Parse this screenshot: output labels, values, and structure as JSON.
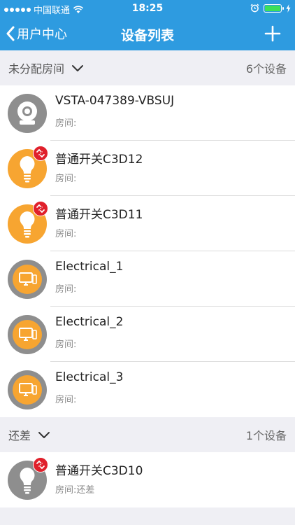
{
  "status_bar": {
    "carrier": "中国联通",
    "time": "18:25"
  },
  "nav": {
    "back_label": "用户中心",
    "title": "设备列表",
    "add_icon": "plus-icon"
  },
  "sections": [
    {
      "name": "未分配房间",
      "count": "6个设备",
      "devices": [
        {
          "name": "VSTA-047389-VBSUJ",
          "room_label": "房间:",
          "room_value": "",
          "icon": "camera-icon",
          "offline_badge": false
        },
        {
          "name": "普通开关C3D12",
          "room_label": "房间:",
          "room_value": "",
          "icon": "bulb-icon",
          "offline_badge": true
        },
        {
          "name": "普通开关C3D11",
          "room_label": "房间:",
          "room_value": "",
          "icon": "bulb-icon",
          "offline_badge": true
        },
        {
          "name": "Electrical_1",
          "room_label": "房间:",
          "room_value": "",
          "icon": "monitor-icon",
          "offline_badge": false
        },
        {
          "name": "Electrical_2",
          "room_label": "房间:",
          "room_value": "",
          "icon": "monitor-icon",
          "offline_badge": false
        },
        {
          "name": "Electrical_3",
          "room_label": "房间:",
          "room_value": "",
          "icon": "monitor-icon",
          "offline_badge": false
        }
      ]
    },
    {
      "name": "还差",
      "count": "1个设备",
      "devices": [
        {
          "name": "普通开关C3D10",
          "room_label": "房间:",
          "room_value": "还差",
          "icon": "bulb-icon",
          "offline_badge": true
        }
      ]
    }
  ],
  "colors": {
    "header_bg": "#2e9be0",
    "icon_orange": "#f7a531",
    "icon_gray": "#8e8e8e",
    "badge_red": "#e0202b"
  }
}
